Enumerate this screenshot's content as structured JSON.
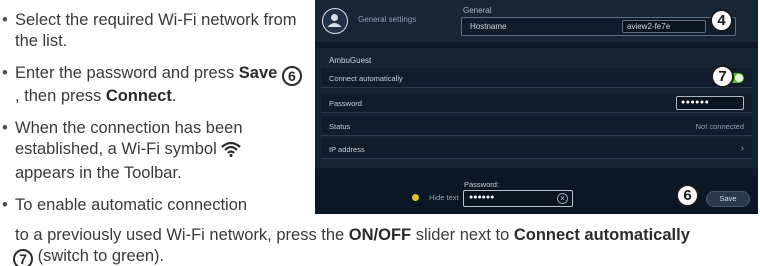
{
  "instructions": {
    "bullet1": "Select the required Wi-Fi network from the list.",
    "bullet2_pre": "Enter the password and press ",
    "bullet2_save": "Save",
    "bullet2_num": "6",
    "bullet2_mid": ", then press ",
    "bullet2_connect": "Connect",
    "bullet2_end": ".",
    "bullet3_pre": "When the connection has been established, a Wi-Fi symbol ",
    "bullet3_post": " appears in the Toolbar.",
    "bullet4_pre": "To enable automatic connection",
    "bullet4_line2_pre": "to a previously used Wi-Fi network, press the ",
    "bullet4_onoff": "ON/OFF",
    "bullet4_mid": " slider next to ",
    "bullet4_connect_auto": "Connect automatically",
    "bullet4_num": "7",
    "bullet4_end": " (switch to green)."
  },
  "screen": {
    "nav_item": "General settings",
    "section_label": "General",
    "hostname_label": "Hostname",
    "hostname_value": "aview2-fe7e",
    "network_name": "AmbuGuest",
    "rows": {
      "connect_auto": "Connect automatically",
      "password": "Password",
      "password_value": "●●●●●●",
      "status": "Status",
      "status_value": "Not connected",
      "ip": "IP address"
    },
    "bottom": {
      "hide_text": "Hide text",
      "password_label": "Password:",
      "password_value": "●●●●●●",
      "save": "Save"
    },
    "callouts": {
      "c4": "4",
      "c6": "6",
      "c7": "7"
    },
    "colors": {
      "toggle_on": "#5fb934",
      "radio": "#d9c62b",
      "background": "#0e1a28"
    }
  }
}
